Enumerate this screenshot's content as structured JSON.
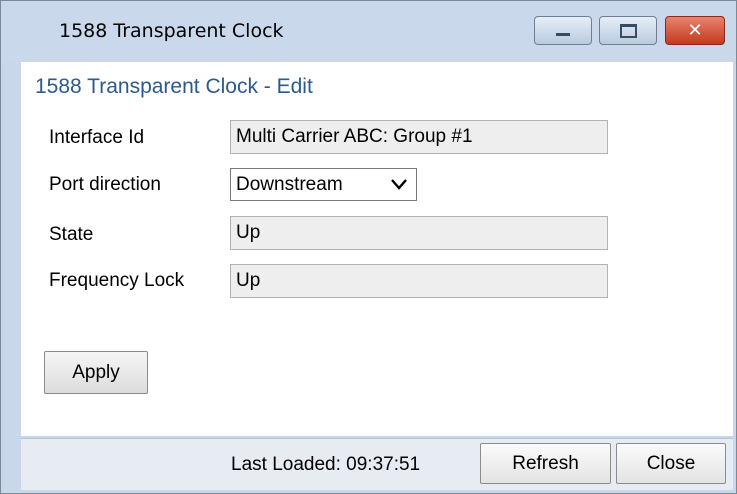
{
  "window": {
    "title": "1588 Transparent Clock",
    "controls": {
      "minimize": "minimize",
      "maximize": "maximize",
      "close": "close"
    }
  },
  "form": {
    "heading": "1588 Transparent Clock - Edit",
    "fields": [
      {
        "label": "Interface Id",
        "value": "Multi Carrier ABC: Group #1"
      },
      {
        "label": "Port direction",
        "value": "Downstream"
      },
      {
        "label": "State",
        "value": "Up"
      },
      {
        "label": "Frequency Lock",
        "value": "Up"
      }
    ],
    "apply_label": "Apply"
  },
  "status": {
    "last_loaded": "Last Loaded: 09:37:51",
    "refresh_label": "Refresh",
    "close_label": "Close"
  },
  "colors": {
    "heading": "#2c5a8c",
    "titlebar": "#c9d9eb",
    "close_button": "#c23a1e"
  },
  "icons": [
    "minimize-icon",
    "maximize-icon",
    "close-icon",
    "chevron-down-icon"
  ]
}
